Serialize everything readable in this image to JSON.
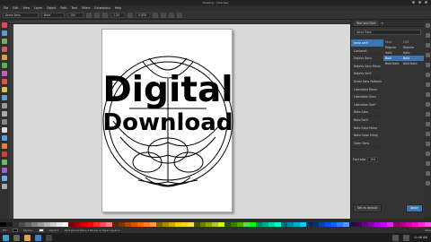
{
  "window": {
    "title": "Drawing - Inkscape"
  },
  "menu": [
    "File",
    "Edit",
    "View",
    "Layer",
    "Object",
    "Path",
    "Text",
    "Filters",
    "Extensions",
    "Help"
  ],
  "tool_controls": {
    "font_family": "Anna Sans",
    "font_style": "Bold",
    "font_size": "104",
    "line_spacing": "1.25",
    "letter_spacing": "0.000"
  },
  "canvas": {
    "title_line1": "Digital",
    "title_line2": "Download"
  },
  "panel": {
    "tab_label": "Text and Font",
    "search_value": "Anna Sans",
    "fonts": [
      "anna serif",
      "Cantarell",
      "DejaVu Sans",
      "DejaVu Sans Mono",
      "DejaVu Serif",
      "Droid Sans Fallback",
      "Liberation Mono",
      "Liberation Sans",
      "Liberation Serif",
      "Noto Sans",
      "Noto Serif",
      "Noto Sans Mono",
      "Noto Color Emoji",
      "Open Sans"
    ],
    "style_header": {
      "face": "Face",
      "css": "CSS"
    },
    "styles": [
      {
        "face": "Regular",
        "css": "Regular"
      },
      {
        "face": "Italic",
        "css": "Italic"
      },
      {
        "face": "Bold",
        "css": "Bold"
      },
      {
        "face": "Bold Italic",
        "css": "Bold Italic"
      }
    ],
    "font_size_label": "Font size",
    "font_size_value": "104",
    "set_default": "Set as default",
    "apply": "Apply"
  },
  "status": {
    "fill_label": "Fill:",
    "stroke_label": "Stroke:",
    "layer": "Layer 1",
    "message": "Text (Anna Sans, 104 px) in layer Layer 1.",
    "zoom": "44%"
  },
  "taskbar": {
    "clock": "11:46 AM"
  }
}
